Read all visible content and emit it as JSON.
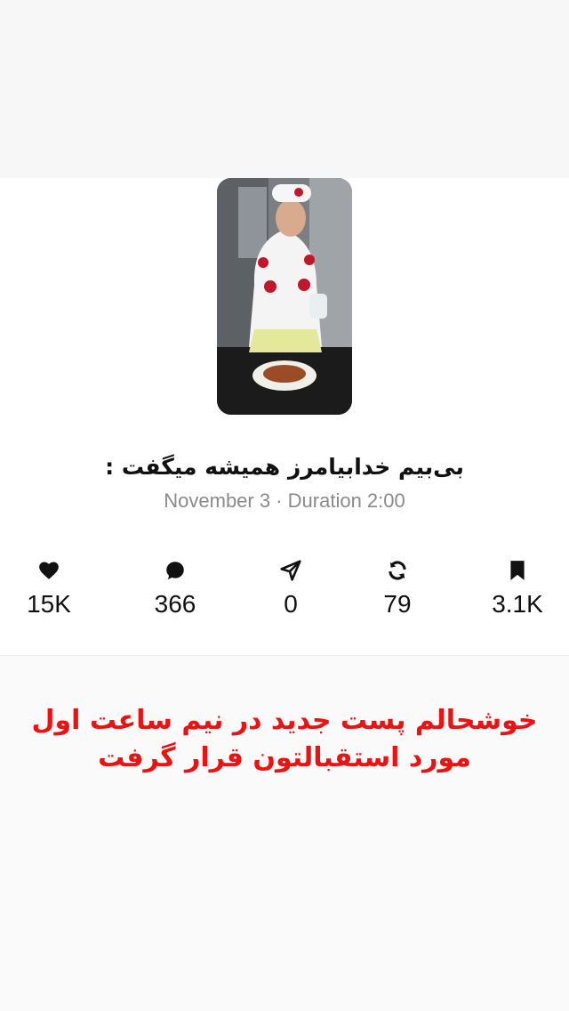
{
  "post": {
    "title": "بی‌بیم خدابیامرز همیشه میگفت :",
    "meta": "November 3 · Duration 2:00"
  },
  "stats": [
    {
      "icon": "heart-icon",
      "count": "15K"
    },
    {
      "icon": "comment-icon",
      "count": "366"
    },
    {
      "icon": "share-icon",
      "count": "0"
    },
    {
      "icon": "repost-icon",
      "count": "79"
    },
    {
      "icon": "bookmark-icon",
      "count": "3.1K"
    }
  ],
  "caption": {
    "line1": "خوشحالم پست جدید در نیم ساعت اول",
    "line2": "مورد استقبالتون قرار گرفت"
  },
  "colors": {
    "caption": "#ee1111",
    "text": "#111111",
    "meta": "#8a8a8a"
  }
}
